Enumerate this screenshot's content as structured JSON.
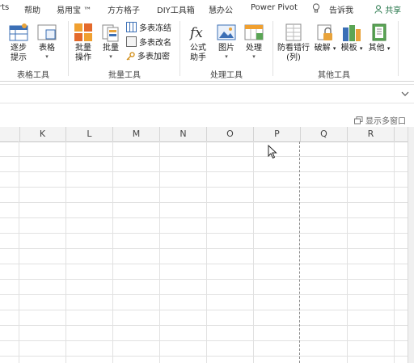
{
  "tabs": [
    {
      "label": "rts"
    },
    {
      "label": "帮助"
    },
    {
      "label": "易用宝 ™"
    },
    {
      "label": "方方格子"
    },
    {
      "label": "DIY工具箱"
    },
    {
      "label": "慧办公"
    },
    {
      "label": "Power Pivot"
    },
    {
      "label": "告诉我"
    },
    {
      "label": "共享"
    }
  ],
  "ribbon": {
    "groups": [
      {
        "label": "表格工具"
      },
      {
        "label": "批量工具"
      },
      {
        "label": "处理工具"
      },
      {
        "label": "其他工具"
      }
    ],
    "buttons": {
      "step_label_1": "逐步",
      "step_label_2": "提示",
      "table_label": "表格",
      "batch_op_label_1": "批量",
      "batch_op_label_2": "操作",
      "batch_label": "批量",
      "multi_freeze": "多表冻结",
      "multi_rename": "多表改名",
      "multi_encrypt": "多表加密",
      "formula_label_1": "公式",
      "formula_label_2": "助手",
      "image_label": "图片",
      "process_label": "处理",
      "antipeek_label_1": "防看错行",
      "antipeek_label_2": "(列)",
      "crack_label": "破解",
      "template_label": "模板",
      "other_label": "其他",
      "caret": "▾"
    }
  },
  "restore_label": "显示多窗口",
  "columns": [
    "K",
    "L",
    "M",
    "N",
    "O",
    "P",
    "Q",
    "R"
  ],
  "colors": {
    "accent": "#217346",
    "grid": "#e1e1e1",
    "header_bg": "#f3f3f3"
  }
}
